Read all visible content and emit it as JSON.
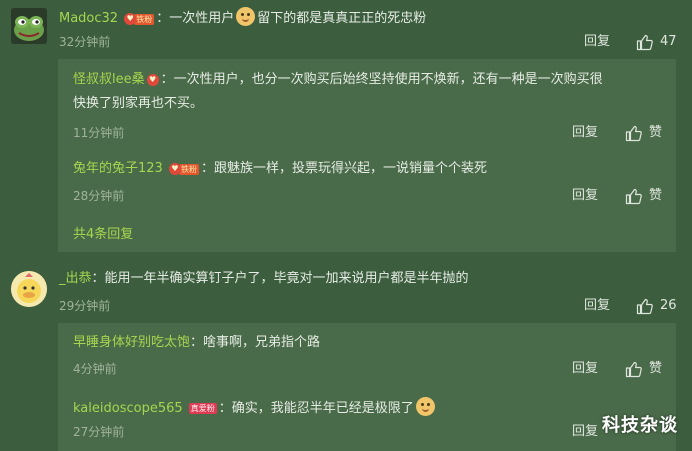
{
  "separator": "：",
  "reply_label": "回复",
  "comments": [
    {
      "user": "Madoc32",
      "badge": "铁粉",
      "text_before_emoji": "一次性用户",
      "text_after_emoji": "留下的都是真真正正的死忠粉",
      "time": "32分钟前",
      "likes": "47",
      "avatar": "frog-avatar",
      "replies": [
        {
          "user": "怪叔叔lee桑",
          "badge": "",
          "text": "一次性用户，也分一次购买后始终坚持使用不焕新，还有一种是一次购买很",
          "text2": "快换了别家再也不买。",
          "time": "11分钟前",
          "like_label": "赞"
        },
        {
          "user": "兔年的兔子123",
          "badge": "铁粉",
          "text": "跟魅族一样，投票玩得兴起，一说销量个个装死",
          "time": "28分钟前",
          "like_label": "赞"
        }
      ],
      "more_replies": "共4条回复"
    },
    {
      "user": "_出恭",
      "text": "能用一年半确实算钉子户了，毕竟对一加来说用户都是半年抛的",
      "time": "29分钟前",
      "likes": "26",
      "avatar": "duck-avatar",
      "replies": [
        {
          "user": "早睡身体好别吃太饱",
          "text": "啥事啊，兄弟指个路",
          "time": "4分钟前",
          "like_label": "赞"
        },
        {
          "user": "kaleidoscope565",
          "badge": "真爱粉",
          "text": "确实，我能忍半年已经是极限了",
          "time": "27分钟前",
          "like_label": "赞"
        }
      ]
    }
  ],
  "watermark": "科技杂谈",
  "colors": {
    "background": "#3c5e3e",
    "reply_box": "#4a6b49",
    "username": "#a6d64f"
  }
}
